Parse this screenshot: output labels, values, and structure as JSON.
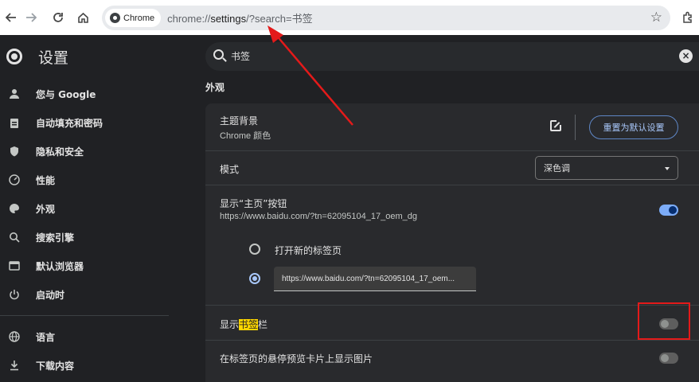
{
  "browser": {
    "chip_label": "Chrome",
    "url_prefix": "chrome://",
    "url_host": "settings",
    "url_rest": "/?search=书签"
  },
  "header": {
    "title": "设置",
    "search_value": "书签"
  },
  "sidebar": {
    "items": [
      {
        "label": "您与 Google",
        "icon": "person-icon"
      },
      {
        "label": "自动填充和密码",
        "icon": "clipboard-icon"
      },
      {
        "label": "隐私和安全",
        "icon": "shield-icon"
      },
      {
        "label": "性能",
        "icon": "speedometer-icon"
      },
      {
        "label": "外观",
        "icon": "palette-icon"
      },
      {
        "label": "搜索引擎",
        "icon": "search-icon"
      },
      {
        "label": "默认浏览器",
        "icon": "browser-icon"
      },
      {
        "label": "启动时",
        "icon": "power-icon"
      },
      {
        "label": "语言",
        "icon": "globe-icon"
      },
      {
        "label": "下载内容",
        "icon": "download-icon"
      }
    ]
  },
  "main": {
    "section_title": "外观",
    "theme": {
      "title": "主题背景",
      "subtitle": "Chrome 颜色",
      "reset_label": "重置为默认设置"
    },
    "mode": {
      "title": "模式",
      "selected": "深色调"
    },
    "home_button": {
      "title": "显示“主页”按钮",
      "subtitle": "https://www.baidu.com/?tn=62095104_17_oem_dg",
      "enabled": true,
      "option_new_tab": "打开新的标签页",
      "option_url_value": "https://www.baidu.com/?tn=62095104_17_oem..."
    },
    "bookmarks_bar": {
      "prefix": "显示",
      "highlight": "书签",
      "suffix": "栏",
      "enabled": false
    },
    "hover_preview": {
      "title": "在标签页的悬停预览卡片上显示图片",
      "enabled": false
    }
  },
  "colors": {
    "accent": "#a8c7fa",
    "background": "#202124",
    "card": "#292a2d",
    "annotation": "#e41a1a"
  }
}
